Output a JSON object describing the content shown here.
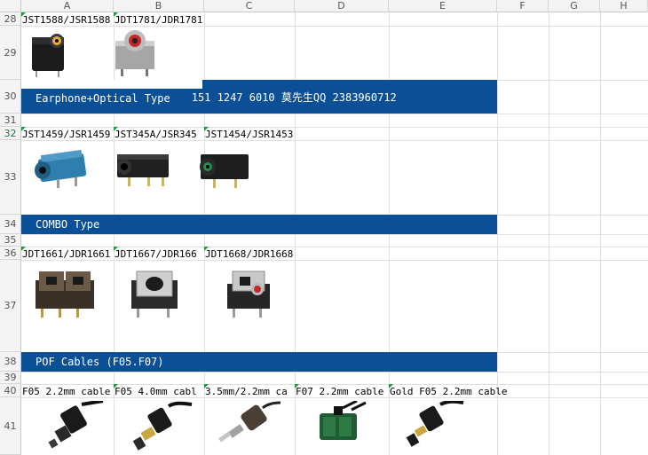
{
  "columns": [
    "A",
    "B",
    "C",
    "D",
    "E",
    "F",
    "G",
    "H"
  ],
  "rows": [
    "28",
    "29",
    "30",
    "31",
    "32",
    "33",
    "34",
    "35",
    "36",
    "37",
    "38",
    "39",
    "40",
    "41"
  ],
  "row28": {
    "a": "JST1588/JSR1588",
    "b": "JDT1781/JDR1781"
  },
  "row30": {
    "title": "Earphone+Optical Type",
    "contact": "151 1247 6010 莫先生QQ 2383960712"
  },
  "row32": {
    "a": "JST1459/JSR1459",
    "b": "JST345A/JSR345",
    "c": "JST1454/JSR1453"
  },
  "row34": {
    "title": "COMBO Type"
  },
  "row36": {
    "a": "JDT1661/JDR1661",
    "b": "JDT1667/JDR166",
    "c": "JDT1668/JDR1668"
  },
  "row38": {
    "title": "POF Cables (F05.F07)"
  },
  "row40": {
    "a": "F05 2.2mm cable",
    "b": "F05 4.0mm cabl",
    "c": "3.5mm/2.2mm ca",
    "d": "F07 2.2mm cable",
    "e": "Gold F05 2.2mm cable"
  },
  "colors": {
    "banner": "#0b4f96",
    "comment_marker": "#1f9a3d",
    "selected_row_header": "#217346"
  },
  "images": [
    "rca-jack-photo",
    "optical-rca-jack-photo",
    "blue-audio-jack-photo",
    "black-audio-jack-photo",
    "green-audio-jack-photo",
    "dual-optical-jack-photo",
    "silver-optical-jack-photo",
    "red-optical-jack-photo",
    "toslink-cable-photo",
    "gold-toslink-cable-photo",
    "mono-plug-cable-photo",
    "green-duplex-connector-photo",
    "gold-f05-plug-photo"
  ]
}
